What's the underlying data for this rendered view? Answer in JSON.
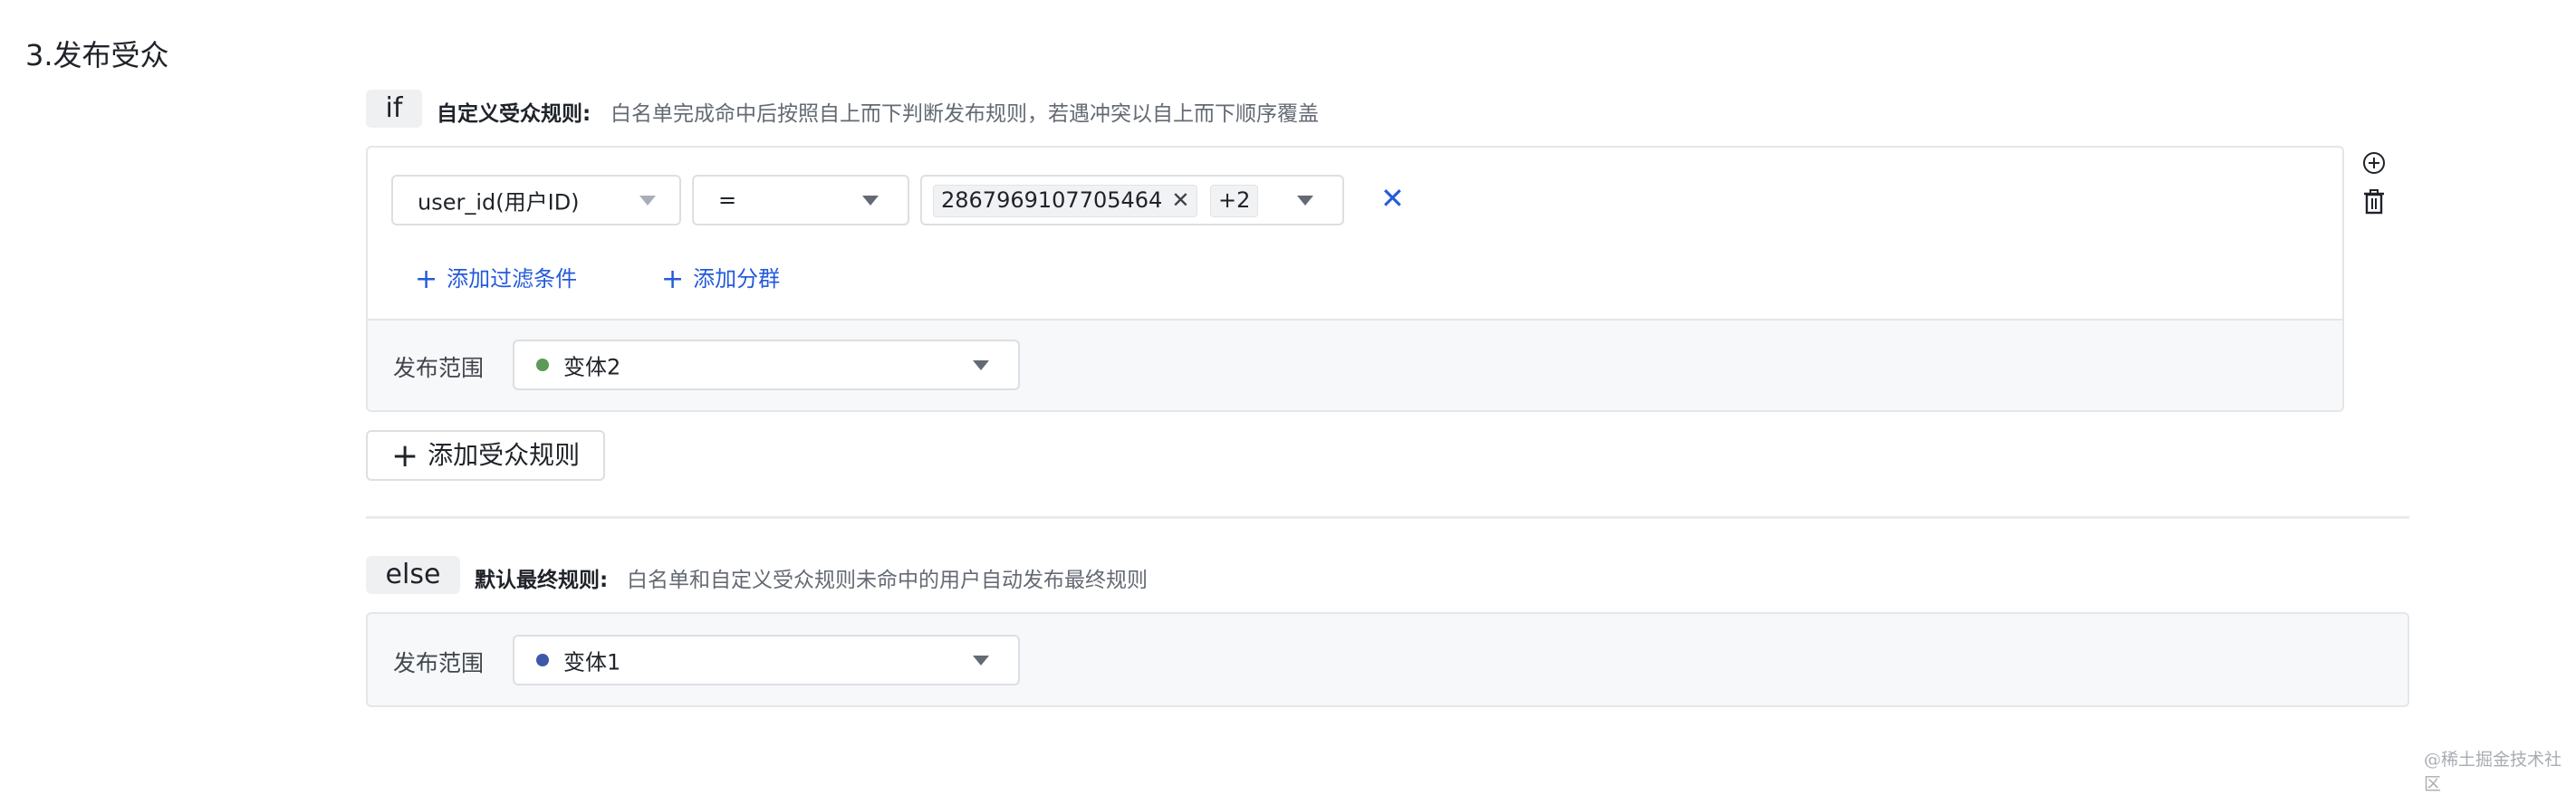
{
  "section": {
    "title": "3.发布受众"
  },
  "if_rule": {
    "tag": "if",
    "title": "自定义受众规则:",
    "desc": "白名单完成命中后按照自上而下判断发布规则，若遇冲突以自上而下顺序覆盖",
    "condition": {
      "field_value": "user_id(用户ID)",
      "operator_value": "=",
      "values": [
        "2867969107705464"
      ],
      "more_count": "+2",
      "remove_icon": "close-icon"
    },
    "add_filter_label": "添加过滤条件",
    "add_group_label": "添加分群",
    "scope_label": "发布范围",
    "scope_value": "变体2",
    "scope_color": "#5d9a59",
    "side_icons": [
      "add-circle-icon",
      "trash-icon"
    ]
  },
  "add_rule_button": "添加受众规则",
  "else_rule": {
    "tag": "else",
    "title": "默认最终规则:",
    "desc": "白名单和自定义受众规则未命中的用户自动发布最终规则",
    "scope_label": "发布范围",
    "scope_value": "变体1",
    "scope_color": "#3e58a9"
  },
  "watermark": "@稀土掘金技术社区",
  "colors": {
    "link": "#245bdb",
    "panel_border": "#e4e6e9",
    "panel_footer": "#f7f8f9"
  }
}
